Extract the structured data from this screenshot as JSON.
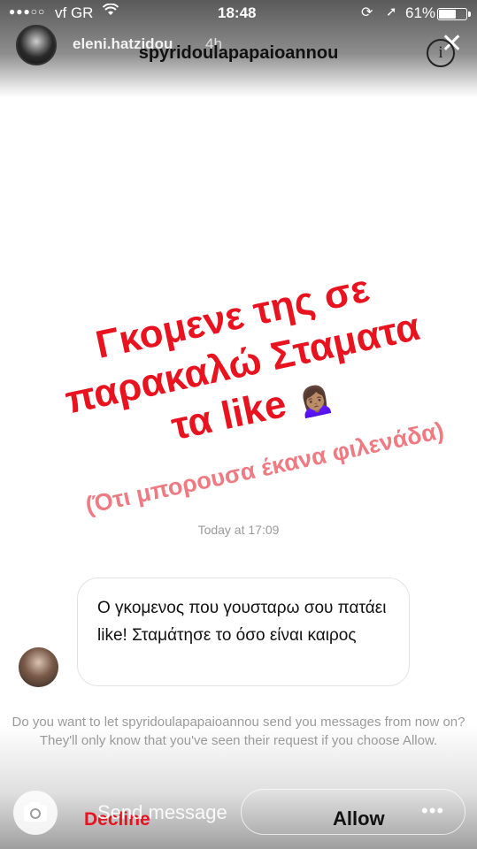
{
  "status_bar": {
    "signal": "●●●○○",
    "carrier": "vf GR",
    "wifi_icon": "wifi-icon",
    "time": "18:48",
    "location_icon": "location-icon",
    "battery_percent": "61%",
    "battery_level": 0.61
  },
  "story_overlay": {
    "username": "eleni.hatzidou",
    "age": "4h",
    "close_icon": "close-icon"
  },
  "header": {
    "thread_title": "spyridoulapapaioannou",
    "info_label": "i"
  },
  "story_content": {
    "main_text": "Γκομενε της σε παρακαλώ Σταματα τα like",
    "emoji": "🙍🏽‍♀️",
    "sub_text": "(Ότι μπορουσα έκανα φιλενάδα)",
    "timestamp": "Today at 17:09"
  },
  "message": {
    "text": "Ο γκομενος που γουσταρω σου πατάει like! Σταμάτησε το όσο είναι καιρος"
  },
  "request_prompt": {
    "text": "Do you want to let spyridoulapapaioannou send you messages from now on? They'll only know that you've seen their request if you choose Allow."
  },
  "bottom_bar": {
    "camera_icon": "camera-icon",
    "send_placeholder": "Send message",
    "decline_label": "Decline",
    "allow_label": "Allow",
    "more_label": "•••"
  },
  "colors": {
    "accent_red": "#e8131f",
    "sub_pink": "#f07a82"
  }
}
